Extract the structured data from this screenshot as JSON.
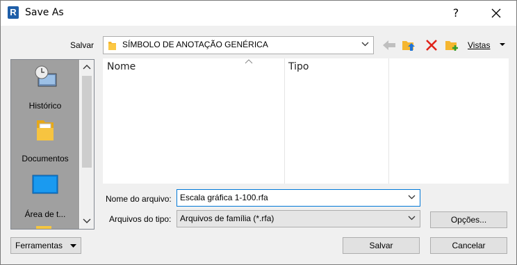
{
  "window": {
    "title": "Save As",
    "app_icon_letter": "R",
    "help": "?",
    "close": "close"
  },
  "location": {
    "label": "Salvar",
    "folder": "SÍMBOLO DE ANOTAÇÃO GENÉRICA"
  },
  "toolbar": {
    "views_label": "Vistas"
  },
  "places": {
    "items": [
      {
        "label": "Histórico",
        "icon": "history-icon"
      },
      {
        "label": "Documentos",
        "icon": "documents-folder-icon"
      },
      {
        "label": "Área de t...",
        "icon": "desktop-icon"
      }
    ]
  },
  "filelist": {
    "columns": [
      "Nome",
      "Tipo"
    ]
  },
  "filename": {
    "label": "Nome do arquivo:",
    "value": "Escala gráfica 1-100.rfa"
  },
  "filetype": {
    "label": "Arquivos do tipo:",
    "value": "Arquivos de família  (*.rfa)"
  },
  "buttons": {
    "tools": "Ferramentas",
    "options": "Opções...",
    "save": "Salvar",
    "cancel": "Cancelar"
  },
  "colors": {
    "accent": "#1e5ea8",
    "folder": "#f5b630",
    "delete": "#e0231a",
    "places_bg": "#a0a0a0"
  }
}
